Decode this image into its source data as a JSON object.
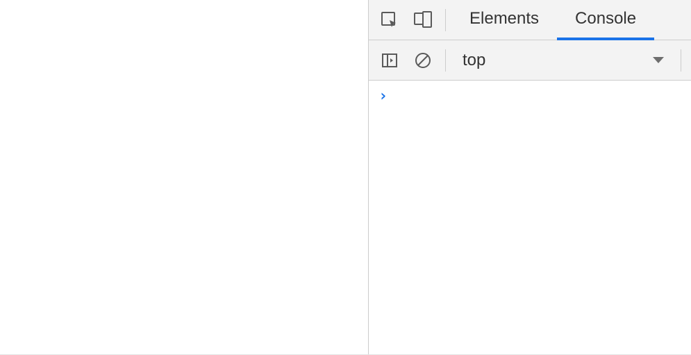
{
  "tabs": {
    "elements": "Elements",
    "console": "Console"
  },
  "toolbar": {
    "context_selected": "top"
  },
  "console": {
    "prompt_symbol": "›"
  }
}
